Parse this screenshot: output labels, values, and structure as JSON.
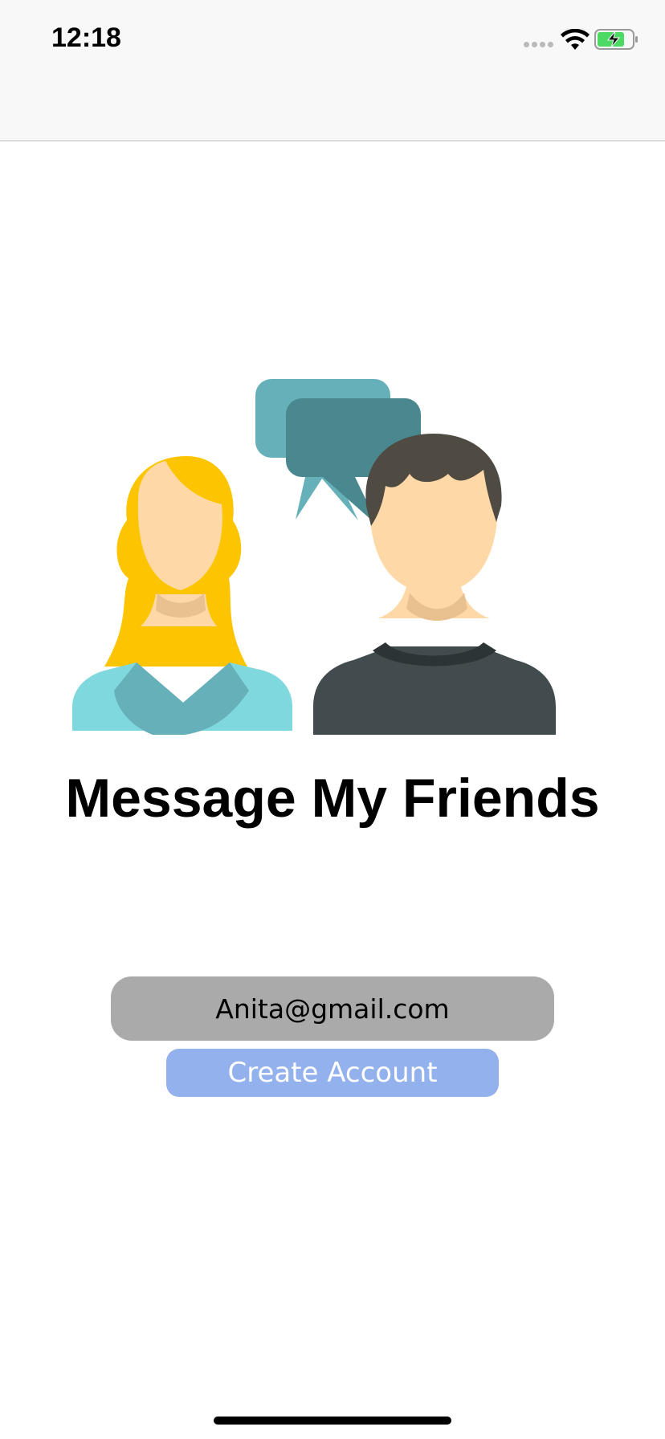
{
  "status_bar": {
    "time": "12:18",
    "signal_icon": "signal-dots-icon",
    "wifi_icon": "wifi-icon",
    "battery_icon": "battery-charging-icon"
  },
  "illustration": {
    "icon": "friends-chatting-illustration",
    "colors": {
      "bubble_back": "#66b0b9",
      "bubble_front": "#4a8890",
      "hair_female": "#fdc501",
      "skin": "#fed9a7",
      "shirt_female": "#80d8df",
      "hair_male": "#4f4a42",
      "shirt_male": "#424c4f"
    }
  },
  "main": {
    "title": "Message My Friends",
    "email_value": "Anita@gmail.com",
    "create_account_label": "Create Account"
  },
  "colors": {
    "email_field_bg": "#aaaaaa",
    "create_button_bg": "#93b1ec"
  }
}
